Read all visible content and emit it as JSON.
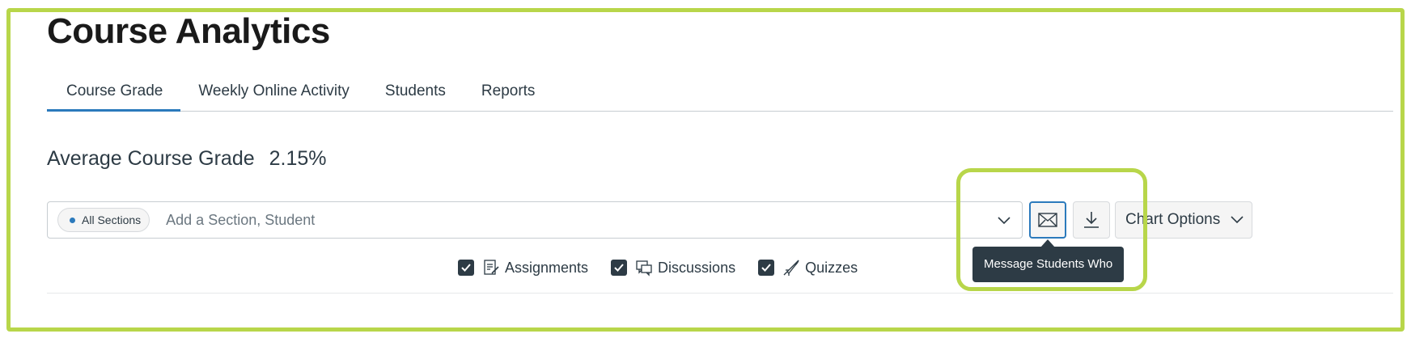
{
  "page": {
    "title": "Course Analytics"
  },
  "tabs": [
    {
      "label": "Course Grade",
      "active": true
    },
    {
      "label": "Weekly Online Activity",
      "active": false
    },
    {
      "label": "Students",
      "active": false
    },
    {
      "label": "Reports",
      "active": false
    }
  ],
  "summary": {
    "label": "Average Course Grade",
    "value": "2.15%"
  },
  "filter": {
    "pill_label": "All Sections",
    "placeholder": "Add a Section, Student"
  },
  "toolbar": {
    "message_icon": "envelope-icon",
    "download_icon": "download-icon",
    "chart_options_label": "Chart Options"
  },
  "tooltip": {
    "text": "Message Students Who"
  },
  "legend": [
    {
      "label": "Assignments",
      "checked": true,
      "icon": "assignment-icon"
    },
    {
      "label": "Discussions",
      "checked": true,
      "icon": "discussion-icon"
    },
    {
      "label": "Quizzes",
      "checked": true,
      "icon": "quiz-icon"
    }
  ],
  "colors": {
    "accent": "#2b7abc",
    "highlight": "#b8d64a",
    "tooltip_bg": "#2d3b45"
  }
}
